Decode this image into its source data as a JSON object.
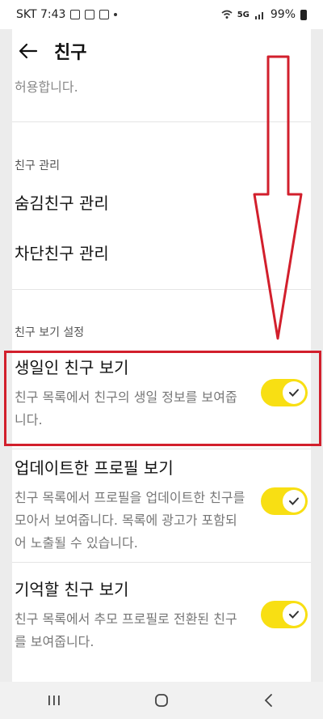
{
  "status_bar": {
    "time": "SKT 7:43",
    "signal_label": "5G",
    "battery_label": "99%",
    "icons": [
      "image-icon",
      "mail-icon",
      "notification-icon",
      "wifi-icon",
      "signal-icon",
      "battery-icon"
    ]
  },
  "appbar": {
    "title": "친구",
    "back_icon": "arrow-left-icon"
  },
  "content": {
    "truncated_text": "허용합니다.",
    "section_manage": {
      "header": "친구 관리",
      "items": [
        "숨김친구 관리",
        "차단친구 관리"
      ]
    },
    "section_view": {
      "header": "친구 보기 설정",
      "settings": [
        {
          "title": "생일인 친구 보기",
          "description": "친구 목록에서 친구의 생일 정보를 보여줍니다.",
          "enabled": true
        },
        {
          "title": "업데이트한 프로필 보기",
          "description": "친구 목록에서 프로필을 업데이트한 친구를 모아서 보여줍니다. 목록에 광고가 포함되어 노출될 수 있습니다.",
          "enabled": true
        },
        {
          "title": "기억할 친구 보기",
          "description": "친구 목록에서 추모 프로필로 전환된 친구를 보여줍니다.",
          "enabled": true
        }
      ]
    }
  },
  "colors": {
    "toggle_on": "#f8df13",
    "highlight": "#d21f2c"
  },
  "nav_bar": {
    "icons": [
      "recent-apps-icon",
      "home-icon",
      "back-icon"
    ]
  }
}
